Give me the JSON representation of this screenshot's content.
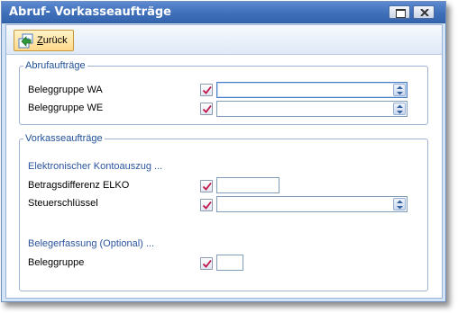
{
  "window": {
    "title": "Abruf- Vorkasseaufträge"
  },
  "toolbar": {
    "back_label_mnemonic": "Z",
    "back_label_rest": "urück"
  },
  "group_abruf": {
    "legend": "Abrufaufträge",
    "fields": [
      {
        "label": "Beleggruppe WA",
        "value": ""
      },
      {
        "label": "Beleggruppe WE",
        "value": ""
      }
    ]
  },
  "group_vorkasse": {
    "legend": "Vorkasseaufträge",
    "section_elko": "Elektronischer Kontoauszug ...",
    "betragsdifferenz_label": "Betragsdifferenz ELKO",
    "betragsdifferenz_value": "",
    "steuerschluessel_label": "Steuerschlüssel",
    "steuerschluessel_value": "",
    "section_belegerfassung": "Belegerfassung (Optional) ...",
    "beleggruppe_label": "Beleggruppe",
    "beleggruppe_value": ""
  },
  "colors": {
    "titlebar": "#3f6fb9",
    "section_text": "#2b55a0",
    "back_button": "#ffd98a",
    "check_mark": "#c0144b"
  },
  "icons": {
    "back": "arrow-back-icon",
    "check": "checkmark-icon",
    "spin": "spin-arrows-icon"
  }
}
